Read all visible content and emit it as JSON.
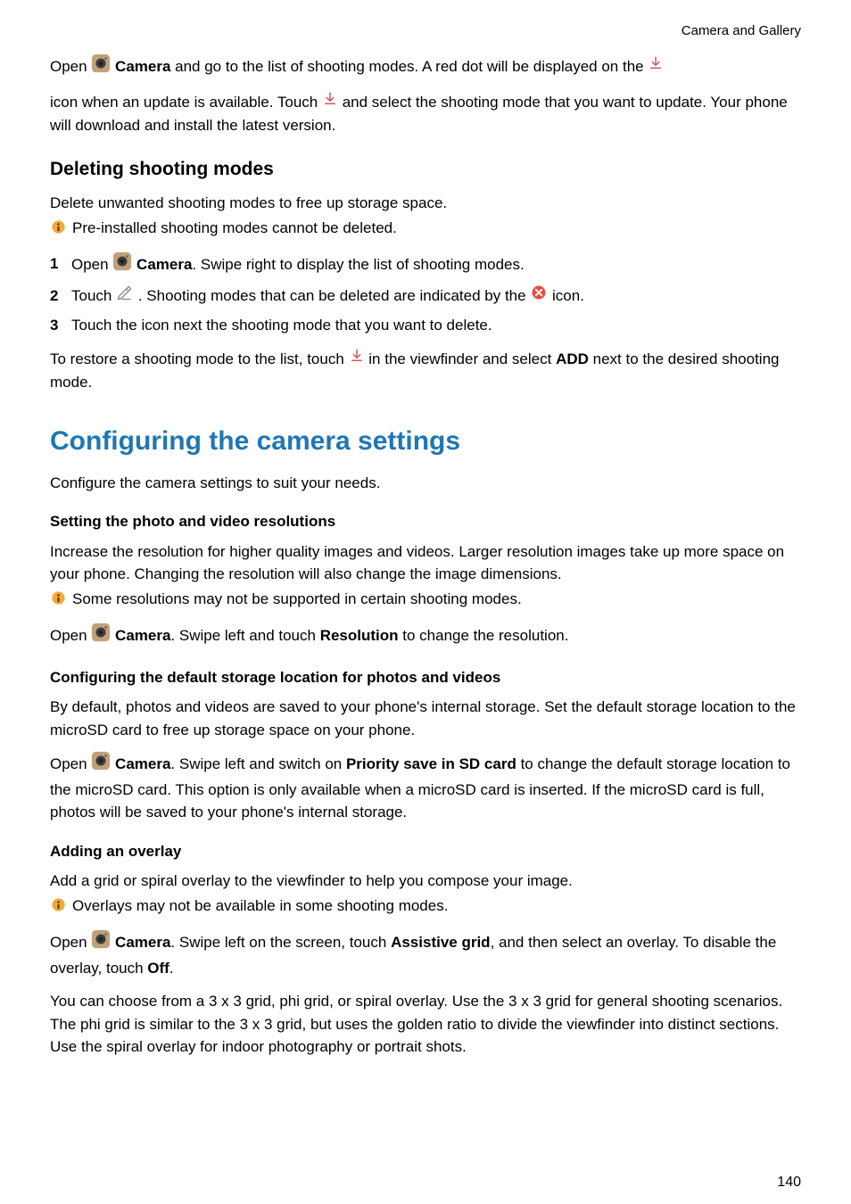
{
  "header": {
    "section": "Camera and Gallery"
  },
  "intro": {
    "p1a": "Open ",
    "camera1": "Camera",
    "p1b": " and go to the list of shooting modes. A red dot will be displayed on the ",
    "p2a": "icon when an update is available. Touch ",
    "p2b": " and select the shooting mode that you want to update. Your phone will download and install the latest version."
  },
  "deleting": {
    "heading": "Deleting shooting modes",
    "p1": "Delete unwanted shooting modes to free up storage space.",
    "note": "Pre-installed shooting modes cannot be deleted.",
    "steps": {
      "n1": "1",
      "s1a": "Open ",
      "s1_cam": "Camera",
      "s1b": ". Swipe right to display the list of shooting modes.",
      "n2": "2",
      "s2a": "Touch ",
      "s2b": " . Shooting modes that can be deleted are indicated by the ",
      "s2c": " icon.",
      "n3": "3",
      "s3": "Touch the icon next the shooting mode that you want to delete."
    },
    "p2a": "To restore a shooting mode to the list, touch ",
    "p2b": " in the viewfinder and select ",
    "add": "ADD",
    "p2c": " next to the desired shooting mode."
  },
  "configuring": {
    "heading": "Configuring the camera settings",
    "intro": "Configure the camera settings to suit your needs.",
    "resolutions": {
      "heading": "Setting the photo and video resolutions",
      "p1": "Increase the resolution for higher quality images and videos. Larger resolution images take up more space on your phone. Changing the resolution will also change the image dimensions.",
      "note": "Some resolutions may not be supported in certain shooting modes.",
      "p2a": "Open ",
      "cam": "Camera",
      "p2b": ". Swipe left and touch ",
      "res": "Resolution",
      "p2c": " to change the resolution."
    },
    "storage": {
      "heading": "Configuring the default storage location for photos and videos",
      "p1": "By default, photos and videos are saved to your phone's internal storage. Set the default storage location to the microSD card to free up storage space on your phone.",
      "p2a": "Open ",
      "cam": "Camera",
      "p2b": ". Swipe left and switch on ",
      "sd": "Priority save in SD card",
      "p2c": " to change the default storage location to the microSD card. This option is only available when a microSD card is inserted. If the microSD card is full, photos will be saved to your phone's internal storage."
    },
    "overlay": {
      "heading": "Adding an overlay",
      "p1": "Add a grid or spiral overlay to the viewfinder to help you compose your image.",
      "note": "Overlays may not be available in some shooting modes.",
      "p2a": "Open ",
      "cam": "Camera",
      "p2b": ". Swipe left on the screen, touch ",
      "grid": "Assistive grid",
      "p2c": ", and then select an overlay. To disable the overlay, touch ",
      "off": "Off",
      "p2d": ".",
      "p3": "You can choose from a 3 x 3 grid, phi grid, or spiral overlay. Use the 3 x 3 grid for general shooting scenarios. The phi grid is similar to the 3 x 3 grid, but uses the golden ratio to divide the viewfinder into distinct sections. Use the spiral overlay for indoor photography or portrait shots."
    }
  },
  "pagenum": "140"
}
